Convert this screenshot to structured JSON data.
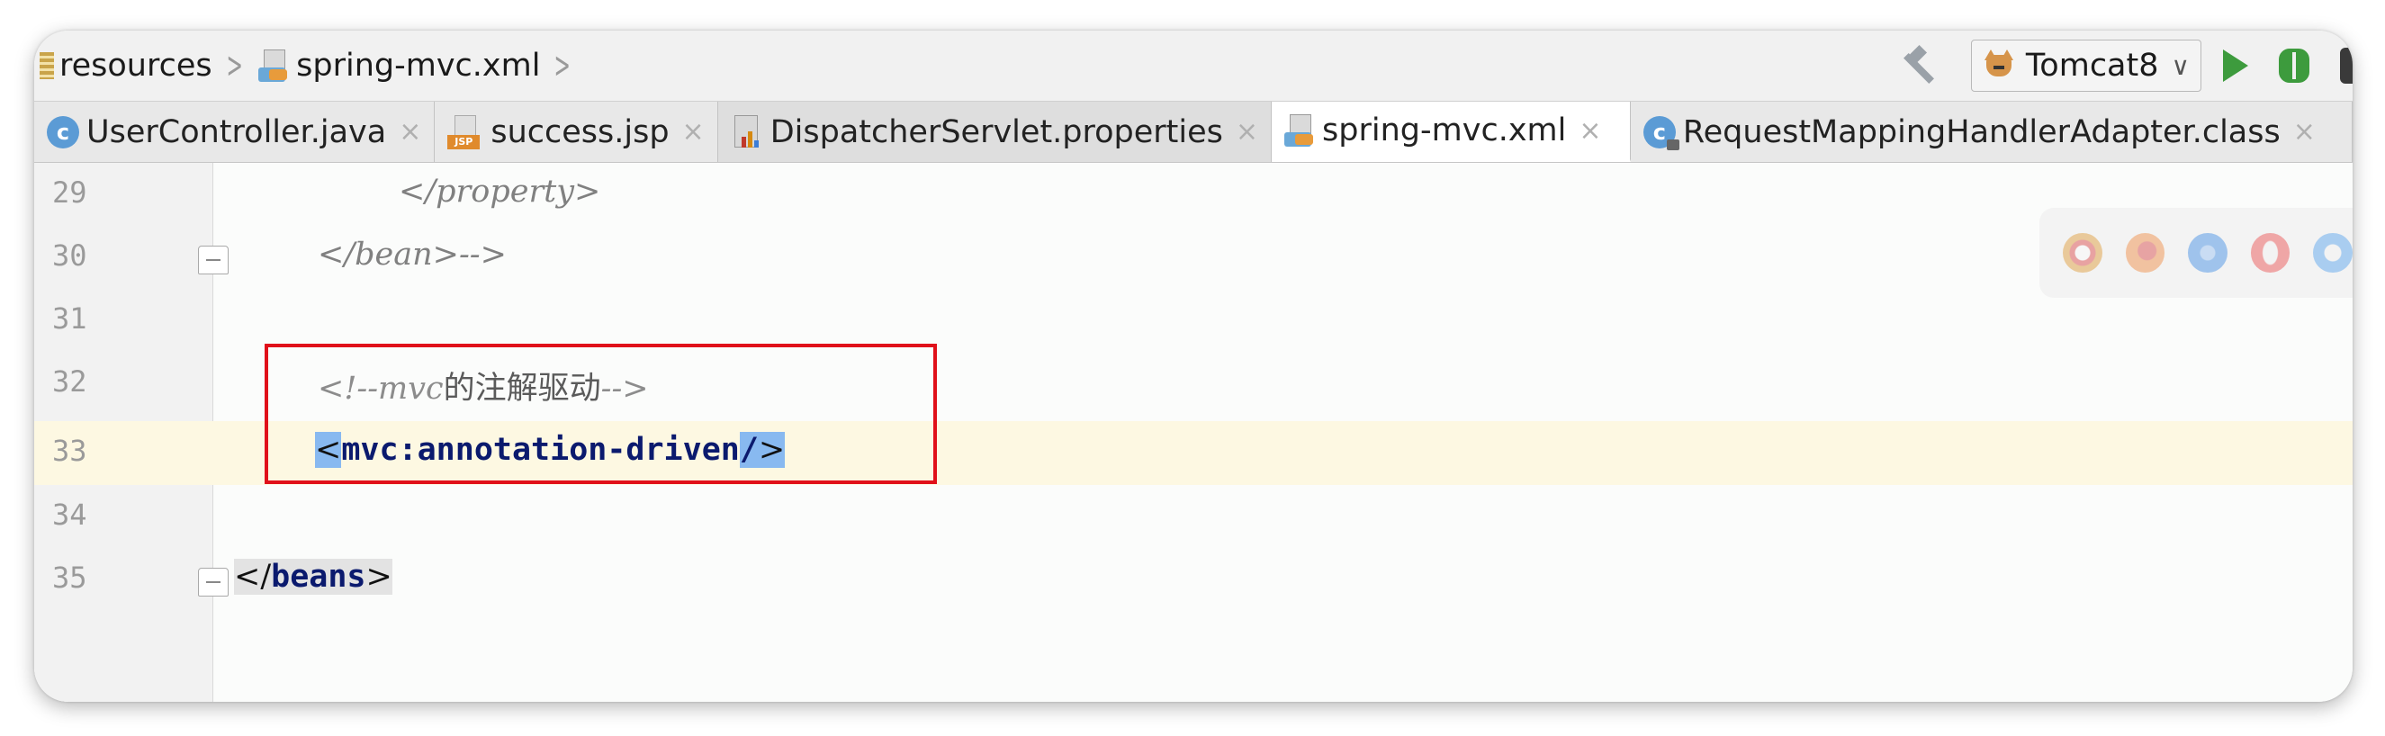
{
  "breadcrumb": {
    "items": [
      "resources",
      "spring-mvc.xml"
    ]
  },
  "toolbar": {
    "run_config": "Tomcat8",
    "icons": [
      "hammer-icon",
      "tomcat-icon",
      "run-icon",
      "debug-icon"
    ]
  },
  "tabs": [
    {
      "label": "UserController.java",
      "icon": "java-class-icon",
      "active": false
    },
    {
      "label": "success.jsp",
      "icon": "jsp-file-icon",
      "active": false
    },
    {
      "label": "DispatcherServlet.properties",
      "icon": "properties-file-icon",
      "active": false
    },
    {
      "label": "spring-mvc.xml",
      "icon": "xml-file-icon",
      "active": true
    },
    {
      "label": "RequestMappingHandlerAdapter.class",
      "icon": "class-file-icon",
      "active": false
    }
  ],
  "tab_close_glyph": "×",
  "editor": {
    "lines": [
      {
        "num": "29",
        "text": "</property>"
      },
      {
        "num": "30",
        "text": "</bean>-->"
      },
      {
        "num": "31",
        "text": ""
      },
      {
        "num": "32",
        "comment_open": "<!--",
        "comment_mvc": "mvc",
        "comment_cn": "的注解驱动",
        "comment_close": "-->"
      },
      {
        "num": "33",
        "lt": "<",
        "tag": "mvc:annotation-driven",
        "slash": "/",
        "gt": ">"
      },
      {
        "num": "34",
        "text": ""
      },
      {
        "num": "35",
        "open": "</",
        "tag": "beans",
        "gt": ">"
      }
    ]
  },
  "browser_icons": [
    "chrome-icon",
    "firefox-icon",
    "safari-icon",
    "opera-icon",
    "ie-icon"
  ],
  "colors": {
    "highlight_box": "#e0101a",
    "current_line": "#fdf8e2",
    "brace_match": "#88b9f0",
    "tag_bold": "#0b1a6e"
  }
}
